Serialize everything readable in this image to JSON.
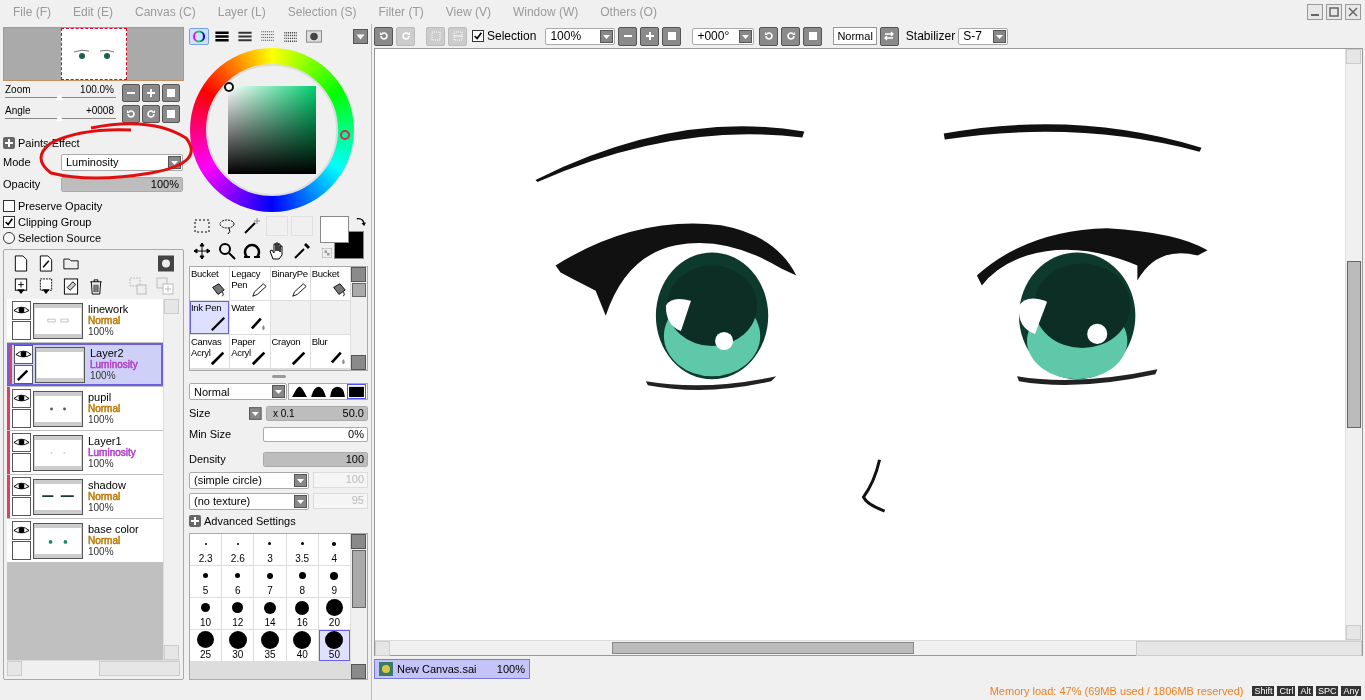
{
  "menu": [
    {
      "label": "File (F)"
    },
    {
      "label": "Edit (E)"
    },
    {
      "label": "Canvas (C)"
    },
    {
      "label": "Layer (L)"
    },
    {
      "label": "Selection (S)"
    },
    {
      "label": "Filter (T)"
    },
    {
      "label": "View (V)"
    },
    {
      "label": "Window (W)"
    },
    {
      "label": "Others (O)"
    }
  ],
  "navigator": {
    "zoom": {
      "label": "Zoom",
      "value": "100.0%",
      "level": 0.5
    },
    "angle": {
      "label": "Angle",
      "value": "+0008",
      "level": 0.5
    }
  },
  "paint_effect": {
    "title": "Paints Effect",
    "mode_label": "Mode",
    "mode_value": "Luminosity",
    "opacity_label": "Opacity",
    "opacity_value": "100%",
    "level": 1
  },
  "layer_options": [
    {
      "kind": "checkbox",
      "label": "Preserve Opacity",
      "checked": false
    },
    {
      "kind": "checkbox",
      "label": "Clipping Group",
      "checked": true
    },
    {
      "kind": "radio",
      "label": "Selection Source",
      "checked": false
    }
  ],
  "layers": [
    {
      "name": "linework",
      "mode": "Normal",
      "color": "#c07800",
      "opacity": "100%",
      "selected": false,
      "clipped": false
    },
    {
      "name": "Layer2",
      "mode": "Luminosity",
      "color": "#b040c8",
      "opacity": "100%",
      "selected": true,
      "clipped": true
    },
    {
      "name": "pupil",
      "mode": "Normal",
      "color": "#c07800",
      "opacity": "100%",
      "selected": false,
      "clipped": true
    },
    {
      "name": "Layer1",
      "mode": "Luminosity",
      "color": "#b040c8",
      "opacity": "100%",
      "selected": false,
      "clipped": true
    },
    {
      "name": "shadow",
      "mode": "Normal",
      "color": "#c07800",
      "opacity": "100%",
      "selected": false,
      "clipped": true
    },
    {
      "name": "base color",
      "mode": "Normal",
      "color": "#c07800",
      "opacity": "100%",
      "selected": false,
      "clipped": false
    }
  ],
  "brushes": [
    {
      "lines": [
        "Bucket"
      ],
      "kind": "bucket",
      "selected": false
    },
    {
      "lines": [
        "Legacy",
        "Pen"
      ],
      "kind": "pencil",
      "selected": false
    },
    {
      "lines": [
        "BinaryPe"
      ],
      "kind": "pencil",
      "selected": false
    },
    {
      "lines": [
        "Bucket"
      ],
      "kind": "bucket",
      "selected": false
    },
    {
      "lines": [
        "Ink Pen"
      ],
      "kind": "pen",
      "selected": true
    },
    {
      "lines": [
        "Water"
      ],
      "kind": "water",
      "selected": false
    },
    {
      "lines": [
        "Canvas",
        "Acryl"
      ],
      "kind": "brush",
      "selected": false
    },
    {
      "lines": [
        "Paper",
        "Acryl"
      ],
      "kind": "brush",
      "selected": false
    },
    {
      "lines": [
        "Crayon"
      ],
      "kind": "brush",
      "selected": false
    },
    {
      "lines": [
        "Blur"
      ],
      "kind": "water",
      "selected": false
    }
  ],
  "brush_settings": {
    "blend": "Normal",
    "tip_shapes": [
      {
        "selected": false
      },
      {
        "selected": false
      },
      {
        "selected": false
      },
      {
        "selected": true
      }
    ],
    "size": {
      "label": "Size",
      "multiplier": "x 0.1",
      "value": "50.0",
      "level": 1
    },
    "min_size": {
      "label": "Min Size",
      "value": "0%",
      "level": 0
    },
    "density": {
      "label": "Density",
      "value": "100",
      "level": 1
    },
    "shape": "(simple circle)",
    "shape_value": "100",
    "texture": "(no texture)",
    "texture_value": "95",
    "advanced": "Advanced Settings"
  },
  "brush_sizes": [
    {
      "label": "2.3",
      "selected": false
    },
    {
      "label": "2.6",
      "selected": false
    },
    {
      "label": "3",
      "selected": false
    },
    {
      "label": "3.5",
      "selected": false
    },
    {
      "label": "4",
      "selected": false
    },
    {
      "label": "5",
      "selected": false
    },
    {
      "label": "6",
      "selected": false
    },
    {
      "label": "7",
      "selected": false
    },
    {
      "label": "8",
      "selected": false
    },
    {
      "label": "9",
      "selected": false
    },
    {
      "label": "10",
      "selected": false
    },
    {
      "label": "12",
      "selected": false
    },
    {
      "label": "14",
      "selected": false
    },
    {
      "label": "16",
      "selected": false
    },
    {
      "label": "20",
      "selected": false
    },
    {
      "label": "25",
      "selected": false
    },
    {
      "label": "30",
      "selected": false
    },
    {
      "label": "35",
      "selected": false
    },
    {
      "label": "40",
      "selected": false
    },
    {
      "label": "50",
      "selected": true
    }
  ],
  "toolbar": {
    "selection_label": "Selection",
    "selection_checked": true,
    "zoom": "100%",
    "angle": "+000°",
    "blend": "Normal",
    "stabilizer_label": "Stabilizer",
    "stabilizer": "S-7"
  },
  "canvas_tab": {
    "name": "New Canvas.sai",
    "zoom": "100%"
  },
  "status_bar": {
    "memory": "Memory load: 47% (69MB used / 1806MB reserved)",
    "keys": [
      "Shift",
      "Ctrl",
      "Alt",
      "SPC",
      "Any"
    ]
  }
}
